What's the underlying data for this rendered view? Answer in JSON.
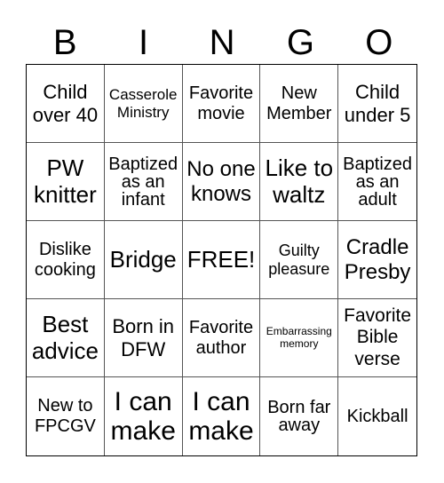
{
  "header": [
    "B",
    "I",
    "N",
    "G",
    "O"
  ],
  "cells": [
    [
      "Child over 40",
      "Casserole Ministry",
      "Favorite movie",
      "New Member",
      "Child under 5"
    ],
    [
      "PW knitter",
      "Baptized as an infant",
      "No one knows",
      "Like to waltz",
      "Baptized as an adult"
    ],
    [
      "Dislike cooking",
      "Bridge",
      "FREE!",
      "Guilty pleasure",
      "Cradle Presby"
    ],
    [
      "Best advice",
      "Born in DFW",
      "Favorite author",
      "Embarrassing memory",
      "Favorite Bible verse"
    ],
    [
      "New to FPCGV",
      "I can make",
      "I can make",
      "Born far away",
      "Kickball"
    ]
  ]
}
